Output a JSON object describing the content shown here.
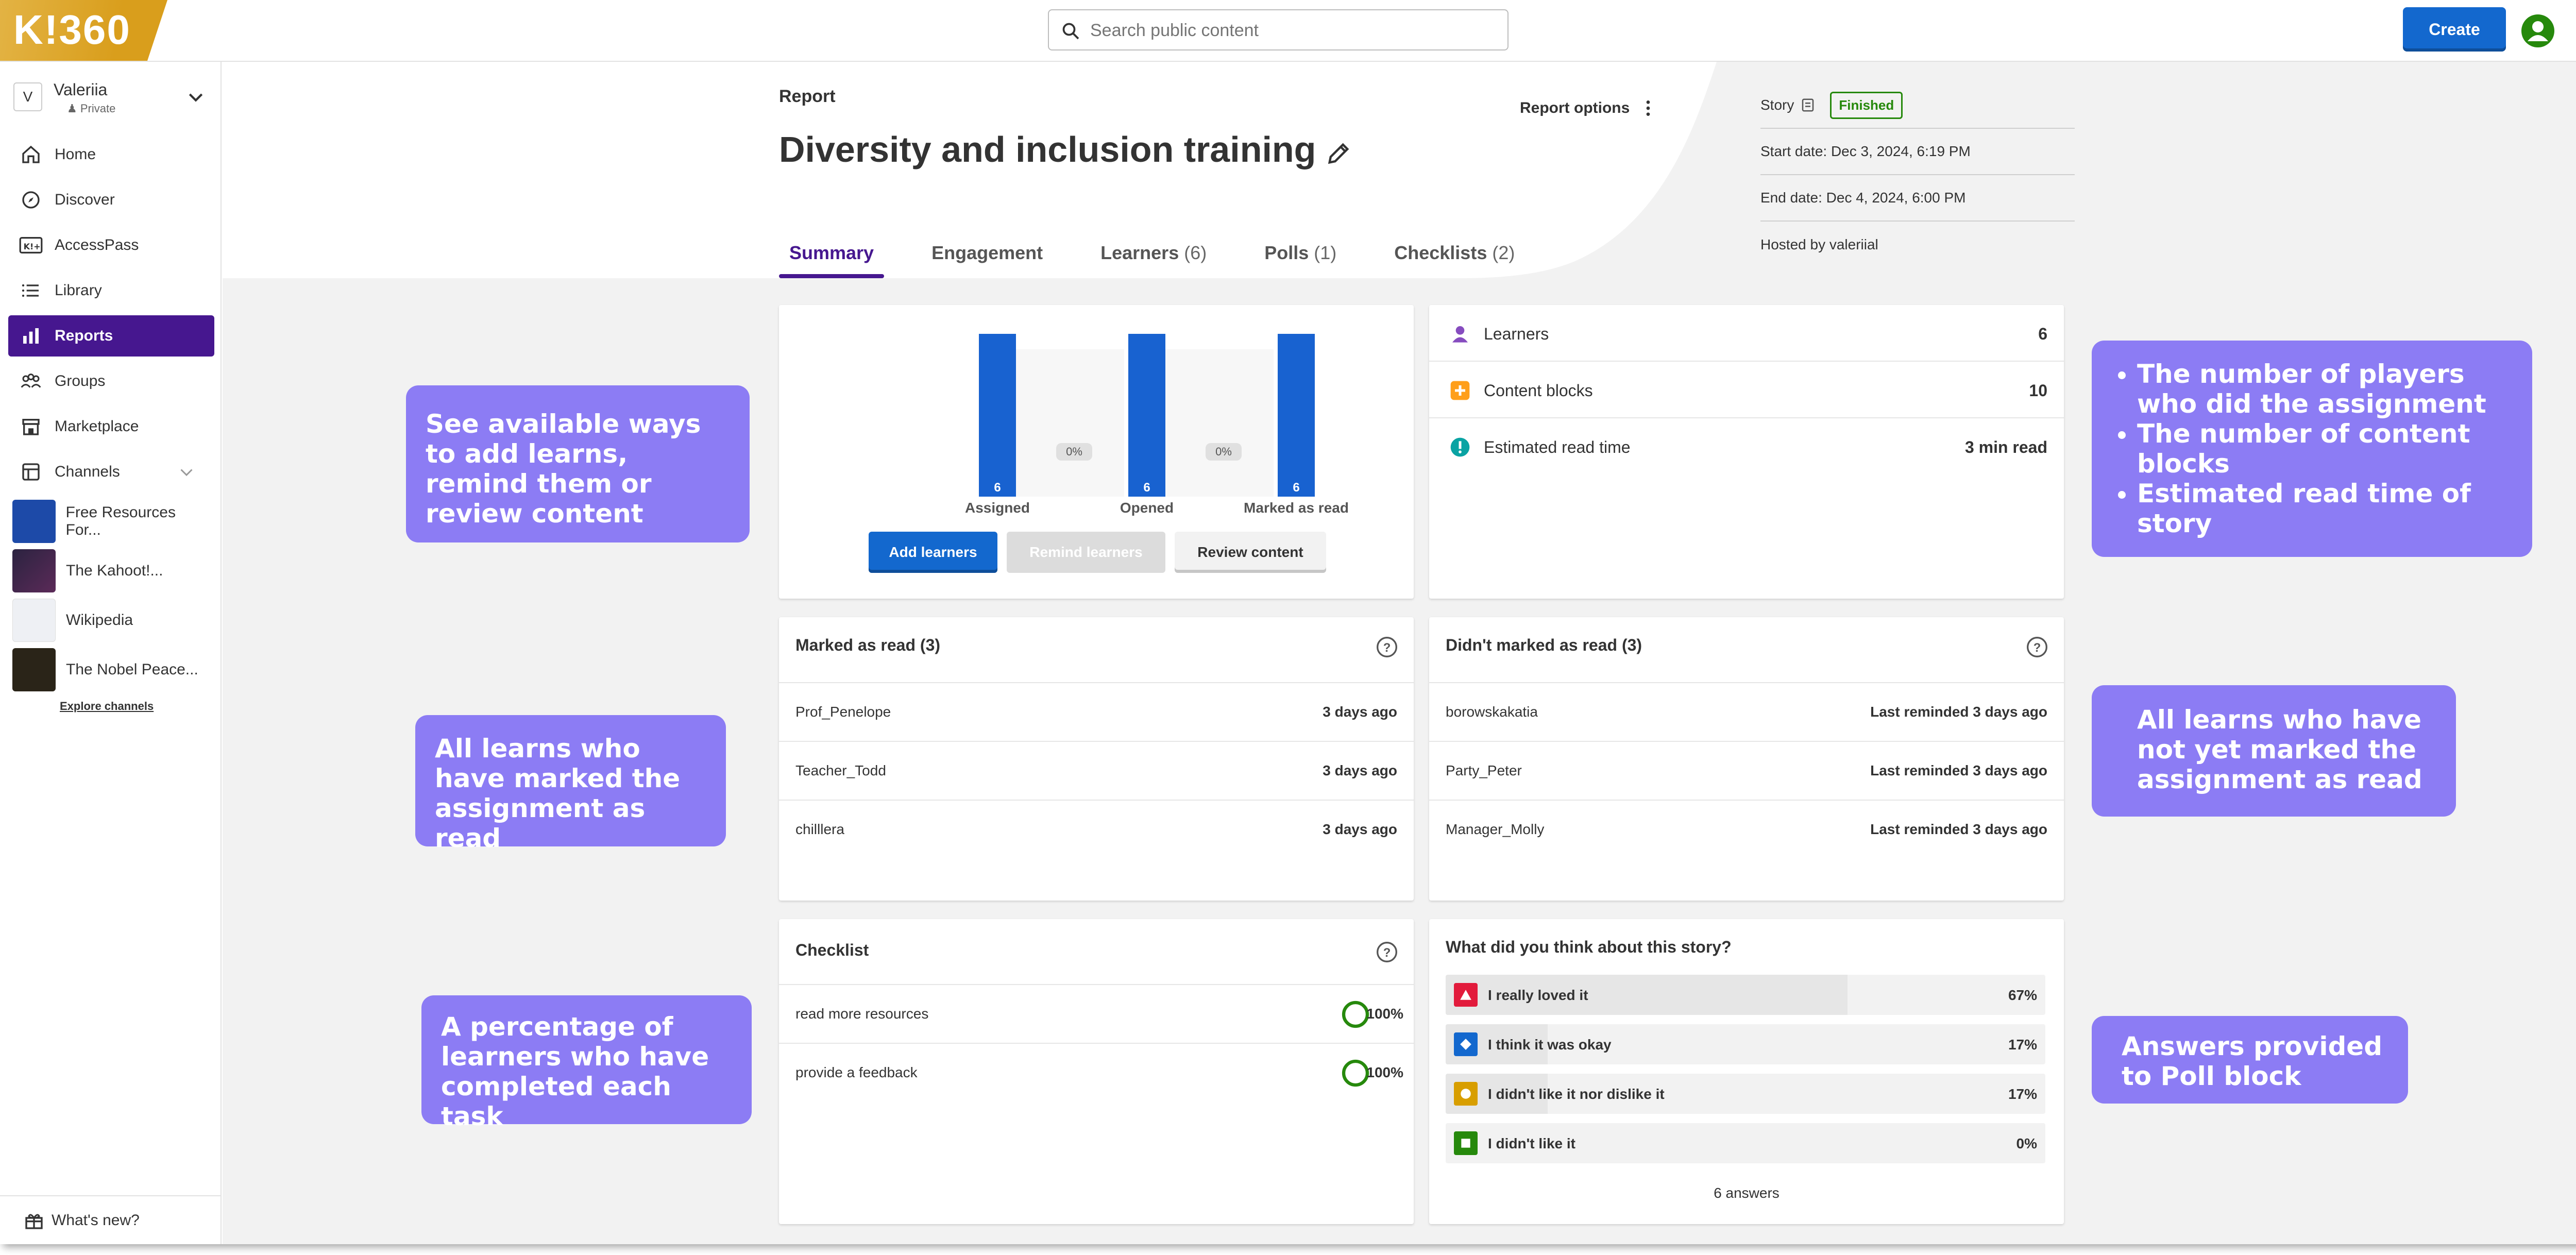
{
  "app": {
    "logo_text": "K!360"
  },
  "search": {
    "placeholder": "Search public content"
  },
  "topbar": {
    "create_label": "Create"
  },
  "user": {
    "initial": "V",
    "name": "Valeriia",
    "visibility": "Private"
  },
  "sidebar": {
    "items": [
      {
        "label": "Home",
        "icon": "home-icon"
      },
      {
        "label": "Discover",
        "icon": "compass-icon"
      },
      {
        "label": "AccessPass",
        "icon": "accesspass-icon"
      },
      {
        "label": "Library",
        "icon": "list-icon"
      },
      {
        "label": "Reports",
        "icon": "bar-chart-icon",
        "active": true
      },
      {
        "label": "Groups",
        "icon": "groups-icon"
      },
      {
        "label": "Marketplace",
        "icon": "store-icon"
      },
      {
        "label": "Channels",
        "icon": "channels-icon"
      }
    ],
    "channels": [
      {
        "label": "Free Resources For..."
      },
      {
        "label": "The Kahoot!..."
      },
      {
        "label": "Wikipedia"
      },
      {
        "label": "The Nobel Peace..."
      }
    ],
    "explore_label": "Explore channels",
    "whats_new_label": "What's new?"
  },
  "report": {
    "label": "Report",
    "title": "Diversity and inclusion training",
    "options_label": "Report options",
    "tabs": [
      {
        "label": "Summary",
        "count": ""
      },
      {
        "label": "Engagement",
        "count": ""
      },
      {
        "label": "Learners",
        "count": "(6)"
      },
      {
        "label": "Polls",
        "count": "(1)"
      },
      {
        "label": "Checklists",
        "count": "(2)"
      }
    ],
    "meta": {
      "type": "Story",
      "status": "Finished",
      "start": "Start date: Dec 3, 2024, 6:19 PM",
      "end": "End date: Dec 4, 2024, 6:00 PM",
      "host": "Hosted by valeriial"
    }
  },
  "funnel": {
    "bars": [
      {
        "label": "Assigned",
        "value": "6"
      },
      {
        "label": "Opened",
        "value": "6"
      },
      {
        "label": "Marked as read",
        "value": "6"
      }
    ],
    "drops": [
      "0%",
      "0%"
    ],
    "buttons": {
      "add": "Add learners",
      "remind": "Remind learners",
      "review": "Review content"
    }
  },
  "stats": [
    {
      "label": "Learners",
      "value": "6",
      "color": "#864cbf"
    },
    {
      "label": "Content blocks",
      "value": "10",
      "color": "#ff9f1a"
    },
    {
      "label": "Estimated read time",
      "value": "3 min read",
      "color": "#0aa3a3"
    }
  ],
  "marked": {
    "title": "Marked as read (3)",
    "rows": [
      {
        "name": "Prof_Penelope",
        "when": "3 days ago"
      },
      {
        "name": "Teacher_Todd",
        "when": "3 days ago"
      },
      {
        "name": "chilllera",
        "when": "3 days ago"
      }
    ]
  },
  "not_marked": {
    "title": "Didn't marked as read (3)",
    "rows": [
      {
        "name": "borowskakatia",
        "when": "Last reminded 3 days ago"
      },
      {
        "name": "Party_Peter",
        "when": "Last reminded 3 days ago"
      },
      {
        "name": "Manager_Molly",
        "when": "Last reminded 3 days ago"
      }
    ]
  },
  "checklist": {
    "title": "Checklist",
    "rows": [
      {
        "label": "read more resources",
        "value": "100%"
      },
      {
        "label": "provide a feedback",
        "value": "100%"
      }
    ]
  },
  "poll": {
    "title": "What did you think about this story?",
    "rows": [
      {
        "label": "I really loved it",
        "value": "67%",
        "pct": 67,
        "color": "#e21b3c"
      },
      {
        "label": "I think it was okay",
        "value": "17%",
        "pct": 17,
        "color": "#1368ce"
      },
      {
        "label": "I didn't like it nor dislike it",
        "value": "17%",
        "pct": 17,
        "color": "#d89e00"
      },
      {
        "label": "I didn't like it",
        "value": "0%",
        "pct": 0,
        "color": "#26890c"
      }
    ],
    "answers": "6 answers"
  },
  "callouts": {
    "c1": "See available ways to add learns, remind them or review content",
    "c2": "All learns who have marked the assignment as read",
    "c3": "A percentage of learners who have completed each task",
    "c4": [
      "The number of players who did the assignment",
      "The number of content blocks",
      "Estimated read time of story"
    ],
    "c5": "All learns who have not yet  marked the assignment as read",
    "c6": "Answers provided to Poll block"
  }
}
